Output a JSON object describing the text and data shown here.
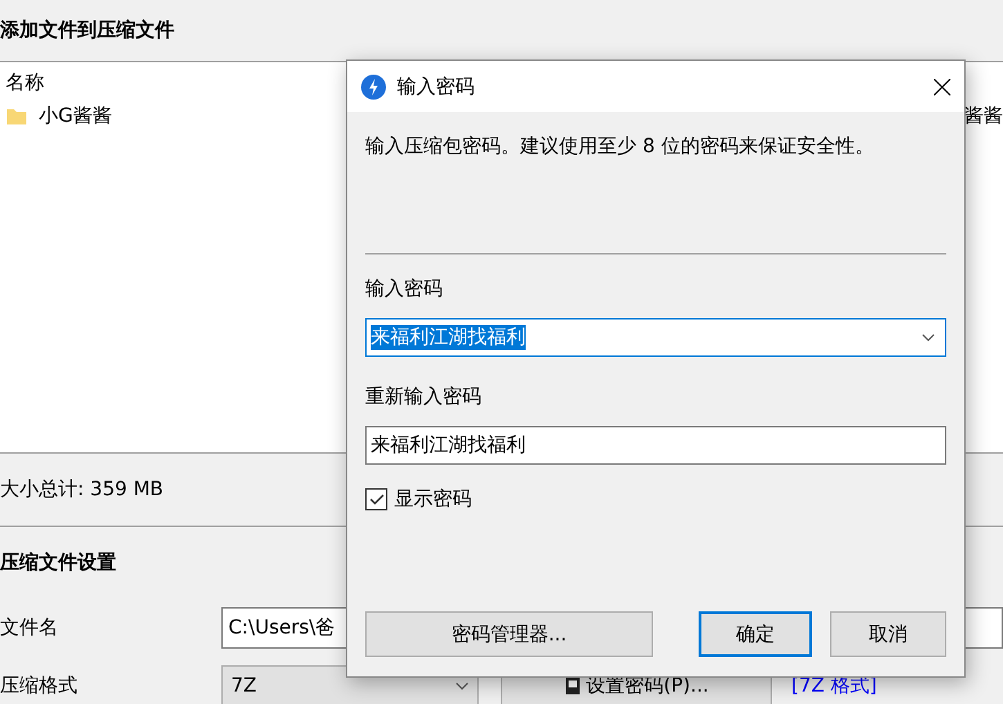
{
  "background_window": {
    "title": "添加文件到压缩文件",
    "file_list": {
      "columns": [
        "名称"
      ],
      "rows": [
        {
          "name": "小G酱酱",
          "column_2": "酱酱"
        }
      ]
    },
    "size_total": "大小总计: 359 MB",
    "settings": {
      "title": "压缩文件设置",
      "file_name": {
        "label": "文件名",
        "value": "C:\\Users\\爸"
      },
      "format": {
        "label": "压缩格式",
        "value": "7Z"
      },
      "password_button": "设置密码(P)...",
      "format_link": "[7Z 格式]"
    }
  },
  "dialog": {
    "title": "输入密码",
    "message": "输入压缩包密码。建议使用至少 8 位的密码来保证安全性。",
    "password": {
      "label": "输入密码",
      "value": "来福利江湖找福利",
      "text_selected": true
    },
    "confirm": {
      "label": "重新输入密码",
      "value": "来福利江湖找福利"
    },
    "show_password": {
      "label": "显示密码",
      "checked": true
    },
    "buttons": [
      {
        "label": "密码管理器...",
        "default": false
      },
      {
        "label": "确定",
        "default": true
      },
      {
        "label": "取消",
        "default": false
      }
    ]
  }
}
